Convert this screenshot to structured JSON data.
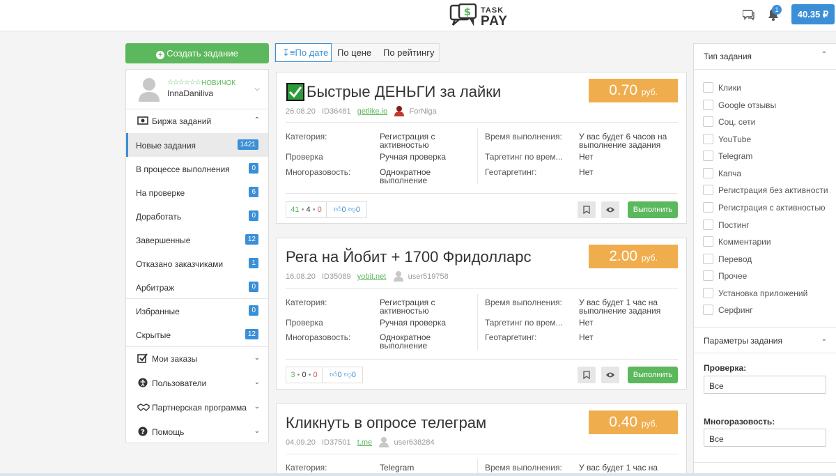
{
  "header": {
    "logo_top": "TASK",
    "logo_bottom": "PAY",
    "notifications_count": "1",
    "balance": "40.35 ₽"
  },
  "create_button": "Создать задание",
  "profile": {
    "stars": "☆☆☆☆☆☆",
    "rank": "НОВИЧОК",
    "username": "InnaDaniliva"
  },
  "sidebar": {
    "exchange_label": "Биржа заданий",
    "items": [
      {
        "label": "Новые задания",
        "count": "1421"
      },
      {
        "label": "В процессе выполнения",
        "count": "0"
      },
      {
        "label": "На проверке",
        "count": "6"
      },
      {
        "label": "Доработать",
        "count": "0"
      },
      {
        "label": "Завершенные",
        "count": "12"
      },
      {
        "label": "Отказано заказчиками",
        "count": "1"
      },
      {
        "label": "Арбитраж",
        "count": "0"
      },
      {
        "label": "Избранные",
        "count": "0"
      },
      {
        "label": "Скрытые",
        "count": "12"
      }
    ],
    "sections": [
      "Мои заказы",
      "Пользователи",
      "Партнерская программа",
      "Помощь"
    ]
  },
  "sort": {
    "by_date": "По дате",
    "by_price": "По цене",
    "by_rating": "По рейтингу"
  },
  "labels": {
    "category": "Категория:",
    "check": "Проверка",
    "repeat": "Многоразовость:",
    "time": "Время выполнения:",
    "targeting_time": "Таргетинг по врем...",
    "geo": "Геотаргетинг:",
    "execute": "Выполнить",
    "currency": "руб."
  },
  "tasks": [
    {
      "title": "Быстрые ДЕНЬГИ за лайки",
      "date": "26.08.20",
      "id": "ID36481",
      "site": "getlike.io",
      "author": "ForNiga",
      "price": "0.70",
      "category": "Регистрация с активностью",
      "check": "Ручная проверка",
      "repeat": "Однократное выполнение",
      "time": "У вас будет 6 часов на выполнение задания",
      "targeting_time": "Нет",
      "geo": "Нет",
      "stat_pos": "41",
      "stat_mid": "4",
      "stat_neg": "0",
      "likes": "0",
      "dislikes": "0"
    },
    {
      "title": "Рега на Йобит + 1700 Фридолларс",
      "date": "16.08.20",
      "id": "ID35089",
      "site": "yobit.net",
      "author": "user519758",
      "price": "2.00",
      "category": "Регистрация с активностью",
      "check": "Ручная проверка",
      "repeat": "Однократное выполнение",
      "time": "У вас будет 1 час на выполнение задания",
      "targeting_time": "Нет",
      "geo": "Нет",
      "stat_pos": "3",
      "stat_mid": "0",
      "stat_neg": "0",
      "likes": "0",
      "dislikes": "0"
    },
    {
      "title": "Кликнуть в опросе телеграм",
      "date": "04.09.20",
      "id": "ID37501",
      "site": "t.me",
      "author": "user638284",
      "price": "0.40",
      "category": "Telegram",
      "time": "У вас будет 1 час на"
    }
  ],
  "filters": {
    "type_title": "Тип задания",
    "types": [
      "Клики",
      "Google отзывы",
      "Соц. сети",
      "YouTube",
      "Telegram",
      "Капча",
      "Регистрация без активности",
      "Регистрация с активностью",
      "Постинг",
      "Комментарии",
      "Перевод",
      "Прочее",
      "Установка приложений",
      "Серфинг"
    ],
    "params_title": "Параметры задания",
    "check_label": "Проверка:",
    "check_value": "Все",
    "repeat_label": "Многоразовость:",
    "repeat_value": "Все"
  },
  "colors": {
    "accent_blue": "#3b8fd6",
    "green": "#5cb85c",
    "orange": "#f0ad4e"
  }
}
